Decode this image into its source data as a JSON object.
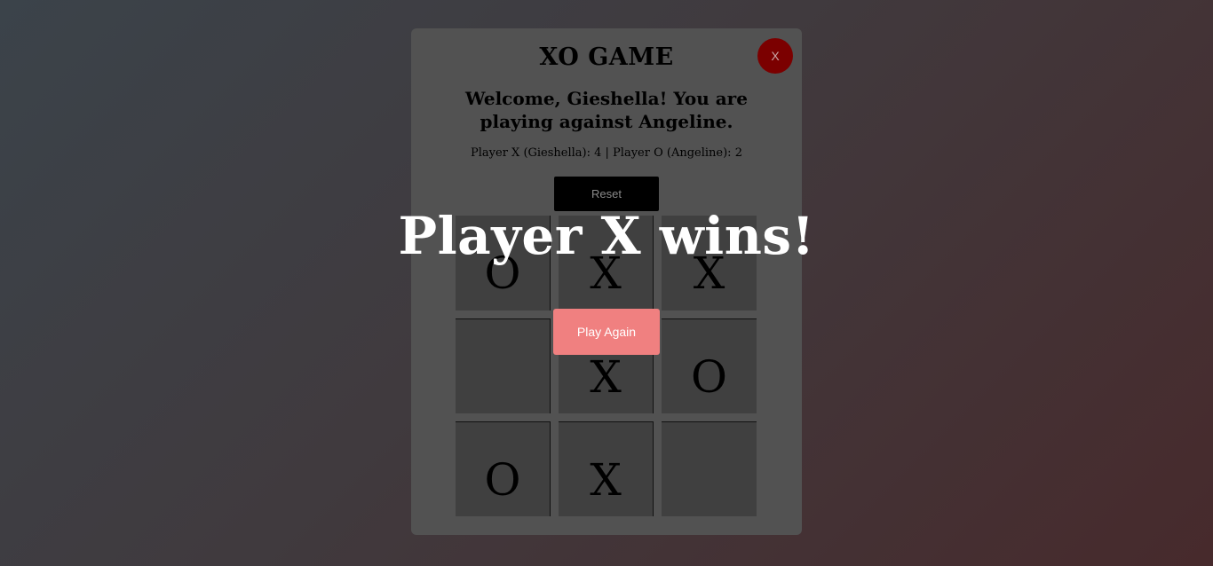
{
  "game": {
    "title": "XO GAME",
    "close_label": "X",
    "welcome": "Welcome, Gieshella! You are playing against Angeline.",
    "score": "Player X (Gieshella): 4 | Player O (Angeline): 2",
    "reset_label": "Reset"
  },
  "board": {
    "cells": [
      "O",
      "X",
      "X",
      "",
      "X",
      "O",
      "O",
      "X",
      ""
    ]
  },
  "result": {
    "message": "Player X wins!",
    "play_again_label": "Play Again"
  },
  "colors": {
    "panel": "#525252",
    "cell": "#404040",
    "close_button": "#7b0000",
    "reset_button": "#000000",
    "play_again_button": "#f08080"
  }
}
